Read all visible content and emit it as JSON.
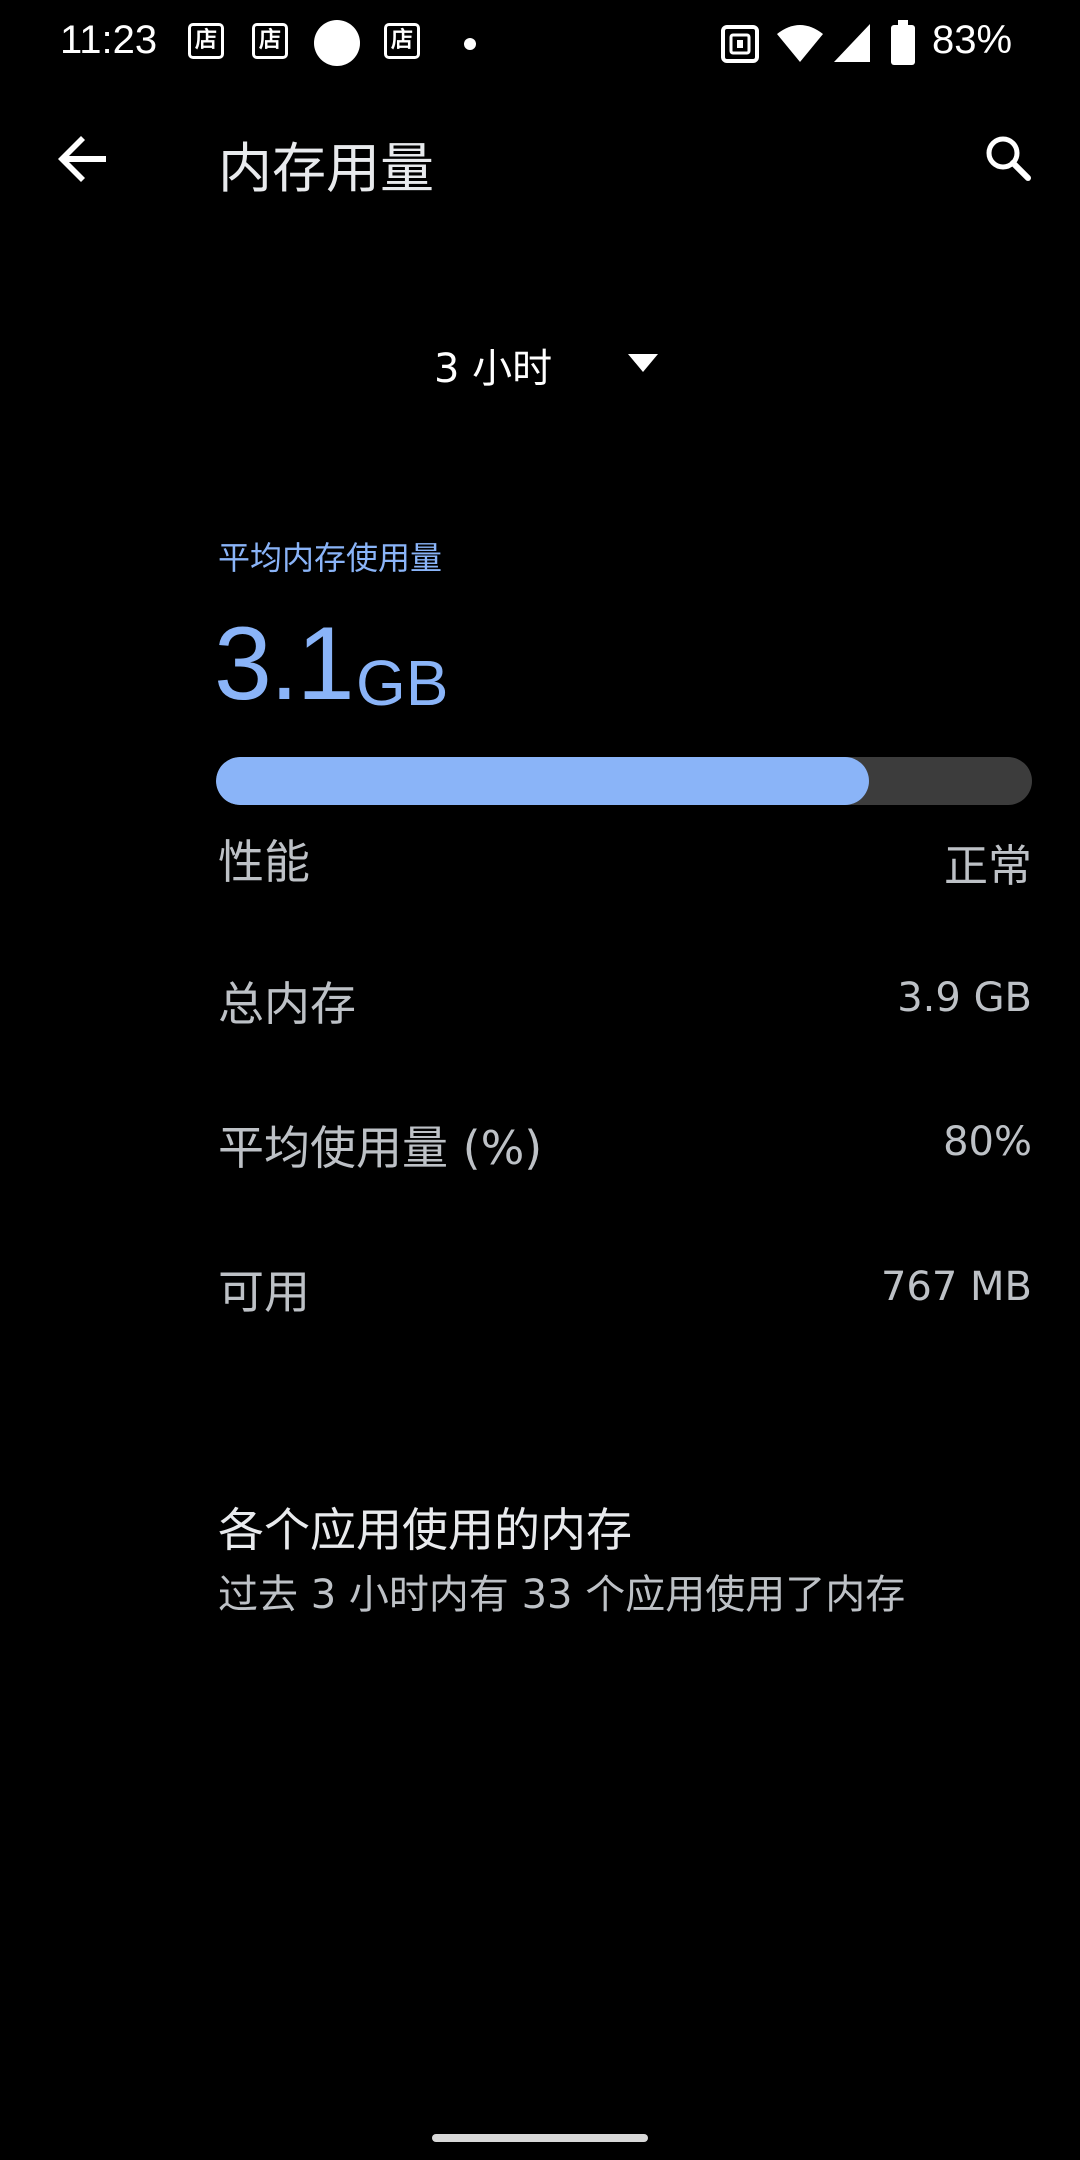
{
  "status_bar": {
    "time": "11:23",
    "notification_glyph": "店",
    "battery_percent": "83%",
    "icons": [
      "store-notification-icon",
      "store-notification-icon",
      "circle-notification-icon",
      "store-notification-icon",
      "more-notifications-dot-icon",
      "nfc-icon",
      "wifi-icon",
      "cell-signal-icon",
      "battery-icon"
    ]
  },
  "app_bar": {
    "title": "内存用量",
    "back_icon": "arrow-back-icon",
    "search_icon": "search-icon"
  },
  "time_range": {
    "selected": "3 小时",
    "caret_icon": "caret-down-icon"
  },
  "average_usage": {
    "label": "平均内存使用量",
    "value": "3.1",
    "unit": "GB",
    "fill_fraction": 0.8,
    "colors": {
      "accent": "#8ab4f8",
      "track": "#3c3c3c"
    }
  },
  "stats": {
    "performance": {
      "label": "性能",
      "value": "正常"
    },
    "total_memory": {
      "label": "总内存",
      "value": "3.9 GB"
    },
    "average_percent": {
      "label": "平均使用量 (%)",
      "value": "80%"
    },
    "available": {
      "label": "可用",
      "value": "767 MB"
    }
  },
  "app_memory": {
    "title": "各个应用使用的内存",
    "subtitle": "过去 3 小时内有 33 个应用使用了内存"
  }
}
